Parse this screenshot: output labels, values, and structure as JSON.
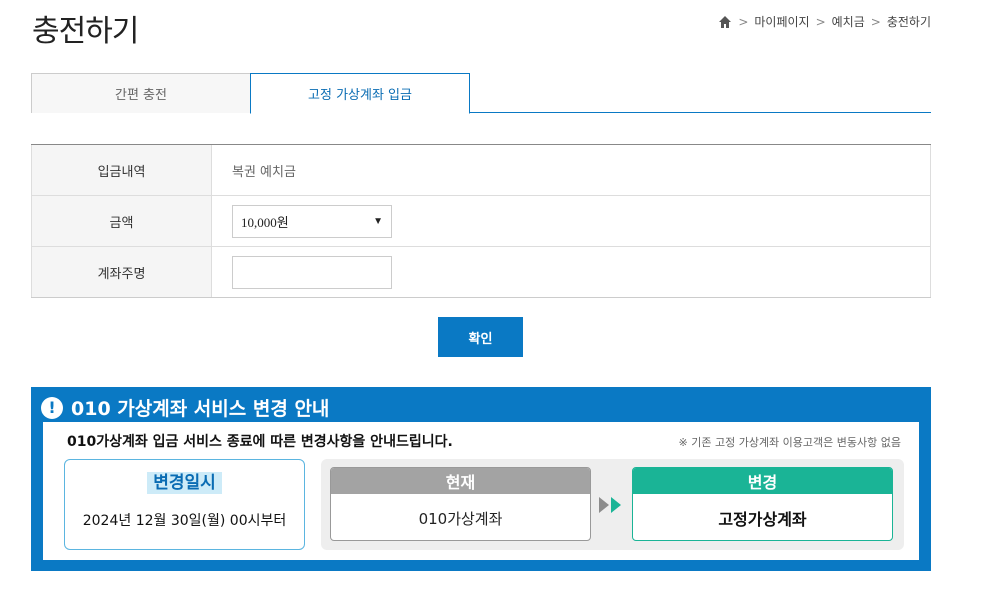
{
  "page": {
    "title": "충전하기"
  },
  "breadcrumb": {
    "items": [
      "마이페이지",
      "예치금",
      "충전하기"
    ],
    "separator": ">"
  },
  "tabs": [
    {
      "label": "간편 충전",
      "active": false
    },
    {
      "label": "고정 가상계좌 입금",
      "active": true
    }
  ],
  "form": {
    "rows": [
      {
        "label": "입금내역",
        "value": "복권 예치금"
      },
      {
        "label": "금액",
        "selected": "10,000원"
      },
      {
        "label": "계좌주명",
        "value": ""
      }
    ]
  },
  "confirm_label": "확인",
  "notice": {
    "title": "010 가상계좌 서비스 변경 안내",
    "subtitle": "010가상계좌 입금 서비스 종료에 따른 변경사항을 안내드립니다.",
    "note": "※ 기존 고정 가상계좌 이용고객은 변동사항 없음",
    "date_label": "변경일시",
    "date_value": "2024년 12월 30일(월) 00시부터",
    "current_label": "현재",
    "current_value": "010가상계좌",
    "new_label": "변경",
    "new_value": "고정가상계좌"
  },
  "colors": {
    "accent": "#0a79c4",
    "green": "#1ab496",
    "gray": "#a3a3a3"
  }
}
